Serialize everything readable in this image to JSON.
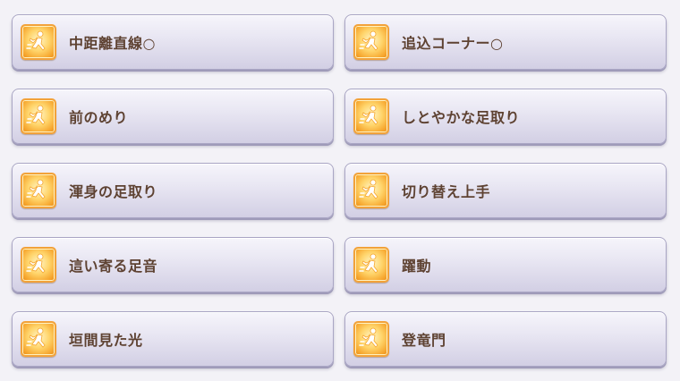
{
  "skills": [
    {
      "name": "中距離直線○",
      "icon": "runner-speed-icon"
    },
    {
      "name": "追込コーナー○",
      "icon": "runner-speed-icon"
    },
    {
      "name": "前のめり",
      "icon": "runner-speed-icon"
    },
    {
      "name": "しとやかな足取り",
      "icon": "runner-speed-icon"
    },
    {
      "name": "渾身の足取り",
      "icon": "runner-speed-icon"
    },
    {
      "name": "切り替え上手",
      "icon": "runner-speed-icon"
    },
    {
      "name": "這い寄る足音",
      "icon": "runner-speed-icon"
    },
    {
      "name": "躍動",
      "icon": "runner-speed-icon"
    },
    {
      "name": "垣間見た光",
      "icon": "runner-speed-icon"
    },
    {
      "name": "登竜門",
      "icon": "runner-speed-icon"
    }
  ],
  "colors": {
    "card_border": "#a9a5c4",
    "icon_gold": "#f6a62e",
    "text_brown": "#5e4232"
  }
}
